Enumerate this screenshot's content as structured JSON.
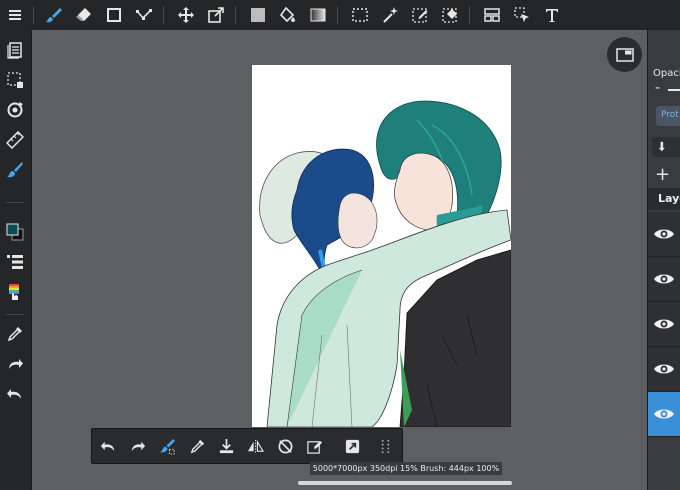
{
  "toolbar": {
    "tools": [
      "menu-icon",
      "brush-icon",
      "eraser-icon",
      "rectangle-icon",
      "edit-node-icon",
      "move-icon",
      "transform-icon",
      "fill-color-icon",
      "bucket-icon",
      "gradient-icon",
      "selection-icon",
      "magic-wand-icon",
      "select-pen-icon",
      "select-eraser-icon",
      "layout-icon",
      "object-select-icon",
      "text-icon"
    ]
  },
  "left_toolbar": {
    "tools": [
      "page-icon",
      "selection-area-icon",
      "rotate-icon",
      "ruler-icon",
      "brush-settings-icon",
      "color-icon",
      "layers-icon",
      "palette-icon",
      "eyedropper-icon",
      "redo-icon",
      "undo-icon"
    ]
  },
  "right_panel": {
    "opacity_label": "Opacity",
    "opacity_minus": "-",
    "protect_label": "Prot",
    "add_label": "+",
    "layer_header": "Layer"
  },
  "bottom_toolbar": {
    "tools": [
      "undo-icon",
      "redo-icon",
      "fill-tool-icon",
      "eyedropper-icon",
      "save-icon",
      "flip-icon",
      "rotate-reset-icon",
      "selection-edit-icon",
      "export-icon",
      "grid-icon"
    ]
  },
  "status": {
    "text": "5000*7000px 350dpi 15% Brush: 444px 100%"
  },
  "colors": {
    "accent": "#3a8fd9",
    "toolbar_bg": "#252628",
    "workspace_bg": "#5e5f63",
    "selected_tool": "#4aa3e8"
  }
}
